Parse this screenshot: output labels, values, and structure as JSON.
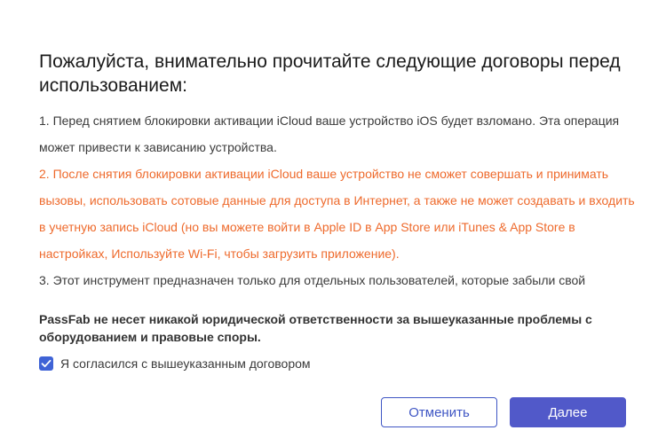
{
  "dialog": {
    "title": "Пожалуйста, внимательно прочитайте следующие договоры перед использованием:",
    "terms": [
      {
        "text": "1. Перед снятием блокировки активации iCloud ваше устройство iOS будет взломано. Эта операция может привести к зависанию устройства.",
        "highlight": false
      },
      {
        "text": "2. После снятия блокировки активации iCloud ваше устройство не сможет совершать и принимать вызовы, использовать сотовые данные для доступа в Интернет, а также не может создавать и входить в учетную запись iCloud (но вы можете войти в Apple ID в App Store или iTunes & App Store в настройках, Используйте Wi-Fi, чтобы загрузить приложение).",
        "highlight": true
      },
      {
        "text": "3. Этот инструмент предназначен только для отдельных пользователей, которые забыли свой",
        "highlight": false
      }
    ],
    "disclaimer": "PassFab не несет никакой юридической ответственности за вышеуказанные проблемы с оборудованием и правовые споры.",
    "agree_label": "Я согласился с вышеуказанным договором",
    "agree_checked": true,
    "cancel_label": "Отменить",
    "next_label": "Далее",
    "colors": {
      "accent": "#5159c9",
      "warning_text": "#ee6a2c",
      "checkbox": "#3f63d6"
    }
  }
}
